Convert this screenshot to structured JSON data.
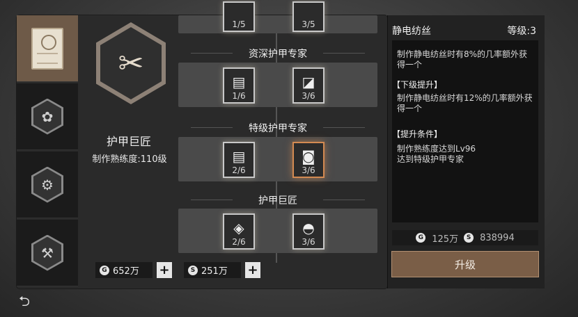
{
  "sidebar": {
    "tabs": [
      {
        "icon": "certificate-icon",
        "active": true
      },
      {
        "icon": "plant-emblem-icon",
        "active": false
      },
      {
        "icon": "gear-emblem-icon",
        "active": false
      },
      {
        "icon": "hammer-emblem-icon",
        "active": false
      }
    ]
  },
  "skill": {
    "emblem_icon": "tower-scissors-icon",
    "title": "护甲巨匠",
    "level_text": "制作熟练度:110级"
  },
  "tree": {
    "top_partial": {
      "nodes": [
        {
          "count": "1/5"
        },
        {
          "count": "3/5"
        }
      ]
    },
    "tiers": [
      {
        "title": "资深护甲专家",
        "nodes": [
          {
            "count": "1/6",
            "icon": "paper-icon"
          },
          {
            "count": "3/6",
            "icon": "fabric-icon"
          }
        ]
      },
      {
        "title": "特级护甲专家",
        "nodes": [
          {
            "count": "2/6",
            "icon": "paper-icon"
          },
          {
            "count": "3/6",
            "icon": "roll-icon",
            "selected": true
          }
        ]
      },
      {
        "title": "护甲巨匠",
        "nodes": [
          {
            "count": "2/6",
            "icon": "armor-icon"
          },
          {
            "count": "3/6",
            "icon": "helmet-icon"
          }
        ]
      }
    ]
  },
  "currency": {
    "gold": "652万",
    "silver": "251万"
  },
  "detail": {
    "name": "静电纺丝",
    "level": "等级:3",
    "desc": "制作静电纺丝时有8%的几率额外获得一个",
    "next_head": "【下级提升】",
    "next_desc": "制作静电纺丝时有12%的几率额外获得一个",
    "req_head": "【提升条件】",
    "req_line1": "制作熟练度达到Lv96",
    "req_line2": "达到特级护甲专家",
    "cost_gold": "125万",
    "cost_silver": "838994",
    "upgrade_label": "升级"
  }
}
